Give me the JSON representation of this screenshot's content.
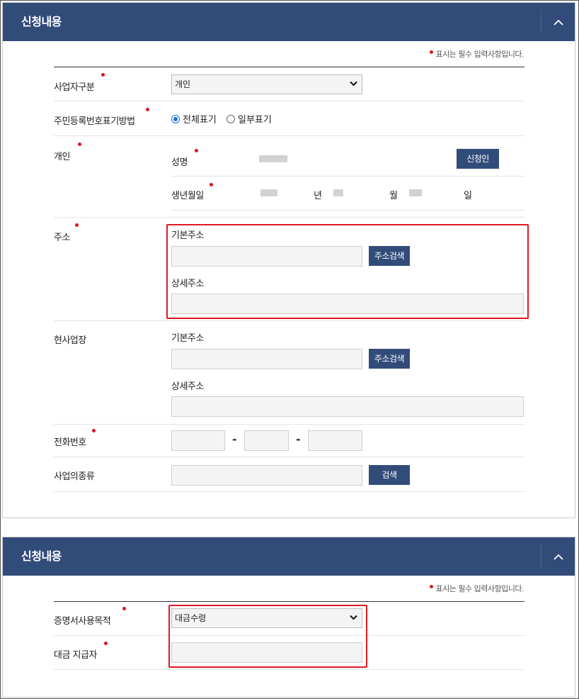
{
  "section1": {
    "title": "신청내용",
    "required_note": "표시는 필수 입력사항입니다.",
    "business_type": {
      "label": "사업자구분",
      "value": "개인"
    },
    "id_display": {
      "label": "주민등록번호표기방법",
      "option_full": "전체표기",
      "option_partial": "일부표기",
      "selected": "전체표기"
    },
    "individual": {
      "label": "개인",
      "name_label": "성명",
      "applicant_button": "신청인",
      "birth_label": "생년월일",
      "year_unit": "년",
      "month_unit": "월",
      "day_unit": "일"
    },
    "address": {
      "label": "주소",
      "basic_label": "기본주소",
      "search_button": "주소검색",
      "detail_label": "상세주소"
    },
    "workplace": {
      "label": "현사업장",
      "basic_label": "기본주소",
      "search_button": "주소검색",
      "detail_label": "상세주소"
    },
    "phone": {
      "label": "전화번호",
      "sep": "-"
    },
    "business_kind": {
      "label": "사업의종류",
      "search_button": "검색"
    }
  },
  "section2": {
    "title": "신청내용",
    "required_note": "표시는 필수 입력사항입니다.",
    "purpose": {
      "label": "증명서사용목적",
      "value": "대금수령"
    },
    "payer": {
      "label": "대금 지급자"
    }
  },
  "colors": {
    "header": "#324c7a",
    "required": "#e0141e",
    "highlight": "#e01a22"
  }
}
